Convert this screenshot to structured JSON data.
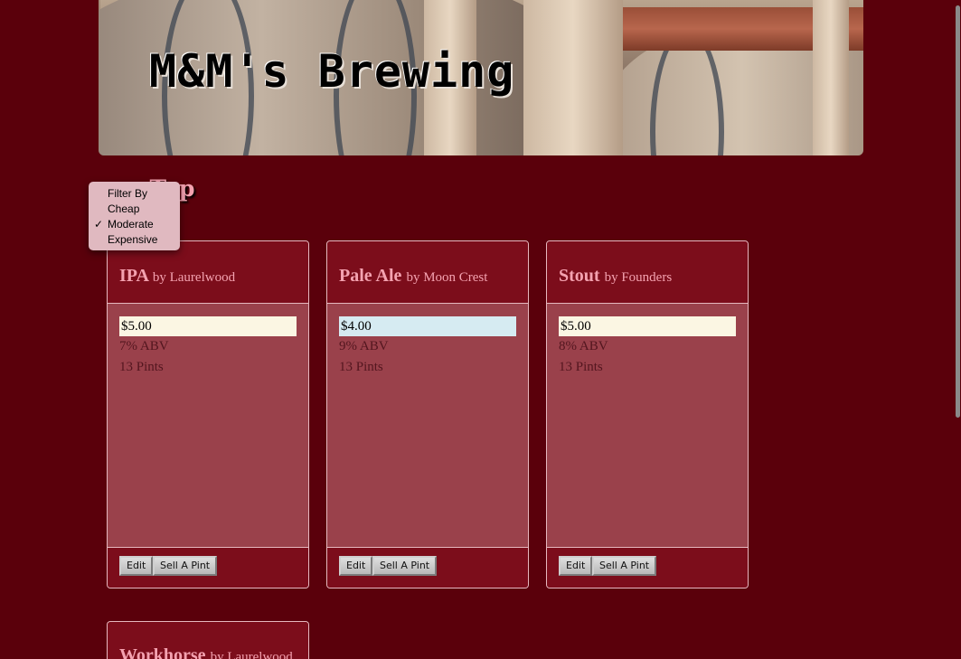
{
  "header": {
    "brand": "M&M's Brewing"
  },
  "section_title": "on Tap",
  "filter": {
    "title": "Filter By",
    "options": [
      {
        "label": "Cheap",
        "checked": false
      },
      {
        "label": "Moderate",
        "checked": true
      },
      {
        "label": "Expensive",
        "checked": false
      }
    ],
    "check_glyph": "✓"
  },
  "beers": [
    {
      "name": "IPA",
      "by": "by Laurelwood",
      "price": "$5.00",
      "abv": "7% ABV",
      "pints": "13 Pints",
      "edit_label": "Edit",
      "sell_label": "Sell A Pint"
    },
    {
      "name": "Pale Ale",
      "by": "by Moon Crest",
      "price": "$4.00",
      "abv": "9% ABV",
      "pints": "13 Pints",
      "edit_label": "Edit",
      "sell_label": "Sell A Pint"
    },
    {
      "name": "Stout",
      "by": "by Founders",
      "price": "$5.00",
      "abv": "8% ABV",
      "pints": "13 Pints",
      "edit_label": "Edit",
      "sell_label": "Sell A Pint"
    },
    {
      "name": "Workhorse",
      "by": "by Laurelwood"
    }
  ],
  "colors": {
    "page_bg": "#5a000b",
    "card_header": "#7c0d1b",
    "card_body": "#9a414b",
    "title_pink": "#f4a2b0"
  }
}
